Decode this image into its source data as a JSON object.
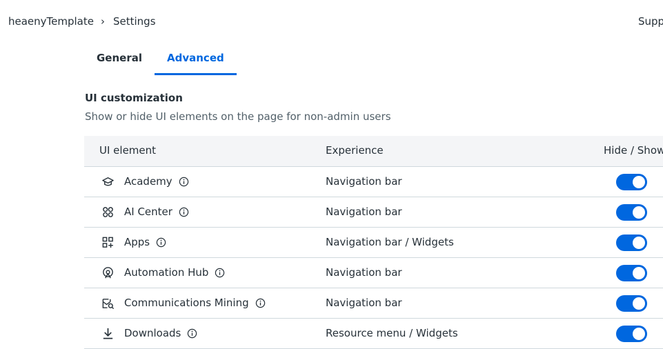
{
  "breadcrumb": {
    "parent": "heaenyTemplate",
    "current": "Settings"
  },
  "header": {
    "support_label": "Supp"
  },
  "tabs": [
    {
      "label": "General",
      "active": false
    },
    {
      "label": "Advanced",
      "active": true
    }
  ],
  "section": {
    "title": "UI customization",
    "description": "Show or hide UI elements on the page for non-admin users"
  },
  "table": {
    "headers": {
      "element": "UI element",
      "experience": "Experience",
      "toggle": "Hide / Show"
    },
    "rows": [
      {
        "icon": "academy-icon",
        "name": "Academy",
        "experience": "Navigation bar",
        "shown": true
      },
      {
        "icon": "ai-center-icon",
        "name": "AI Center",
        "experience": "Navigation bar",
        "shown": true
      },
      {
        "icon": "apps-icon",
        "name": "Apps",
        "experience": "Navigation bar / Widgets",
        "shown": true
      },
      {
        "icon": "automation-hub-icon",
        "name": "Automation Hub",
        "experience": "Navigation bar",
        "shown": true
      },
      {
        "icon": "communications-mining-icon",
        "name": "Communications Mining",
        "experience": "Navigation bar",
        "shown": true
      },
      {
        "icon": "download-icon",
        "name": "Downloads",
        "experience": "Resource menu / Widgets",
        "shown": true
      }
    ]
  },
  "colors": {
    "accent": "#0067df",
    "text": "#273139",
    "muted": "#526069",
    "header_bg": "#f4f5f7",
    "divider": "#cfd8dd"
  }
}
